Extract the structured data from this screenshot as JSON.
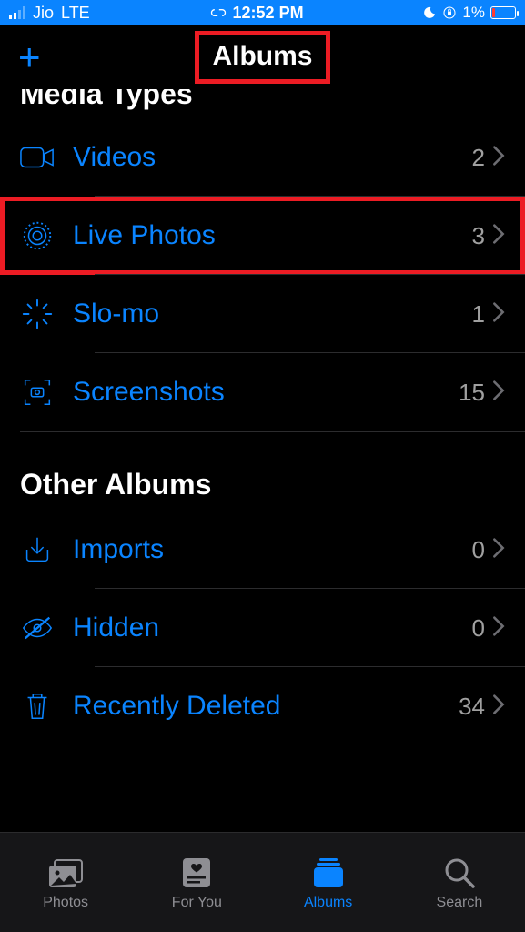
{
  "status": {
    "carrier": "Jio",
    "network": "LTE",
    "time": "12:52 PM",
    "battery_pct": "1%"
  },
  "nav": {
    "title": "Albums"
  },
  "sections": {
    "media_types": {
      "title": "Media Types",
      "items": [
        {
          "label": "Videos",
          "count": "2"
        },
        {
          "label": "Live Photos",
          "count": "3"
        },
        {
          "label": "Slo-mo",
          "count": "1"
        },
        {
          "label": "Screenshots",
          "count": "15"
        }
      ]
    },
    "other_albums": {
      "title": "Other Albums",
      "items": [
        {
          "label": "Imports",
          "count": "0"
        },
        {
          "label": "Hidden",
          "count": "0"
        },
        {
          "label": "Recently Deleted",
          "count": "34"
        }
      ]
    }
  },
  "tabs": {
    "items": [
      {
        "label": "Photos"
      },
      {
        "label": "For You"
      },
      {
        "label": "Albums"
      },
      {
        "label": "Search"
      }
    ]
  }
}
